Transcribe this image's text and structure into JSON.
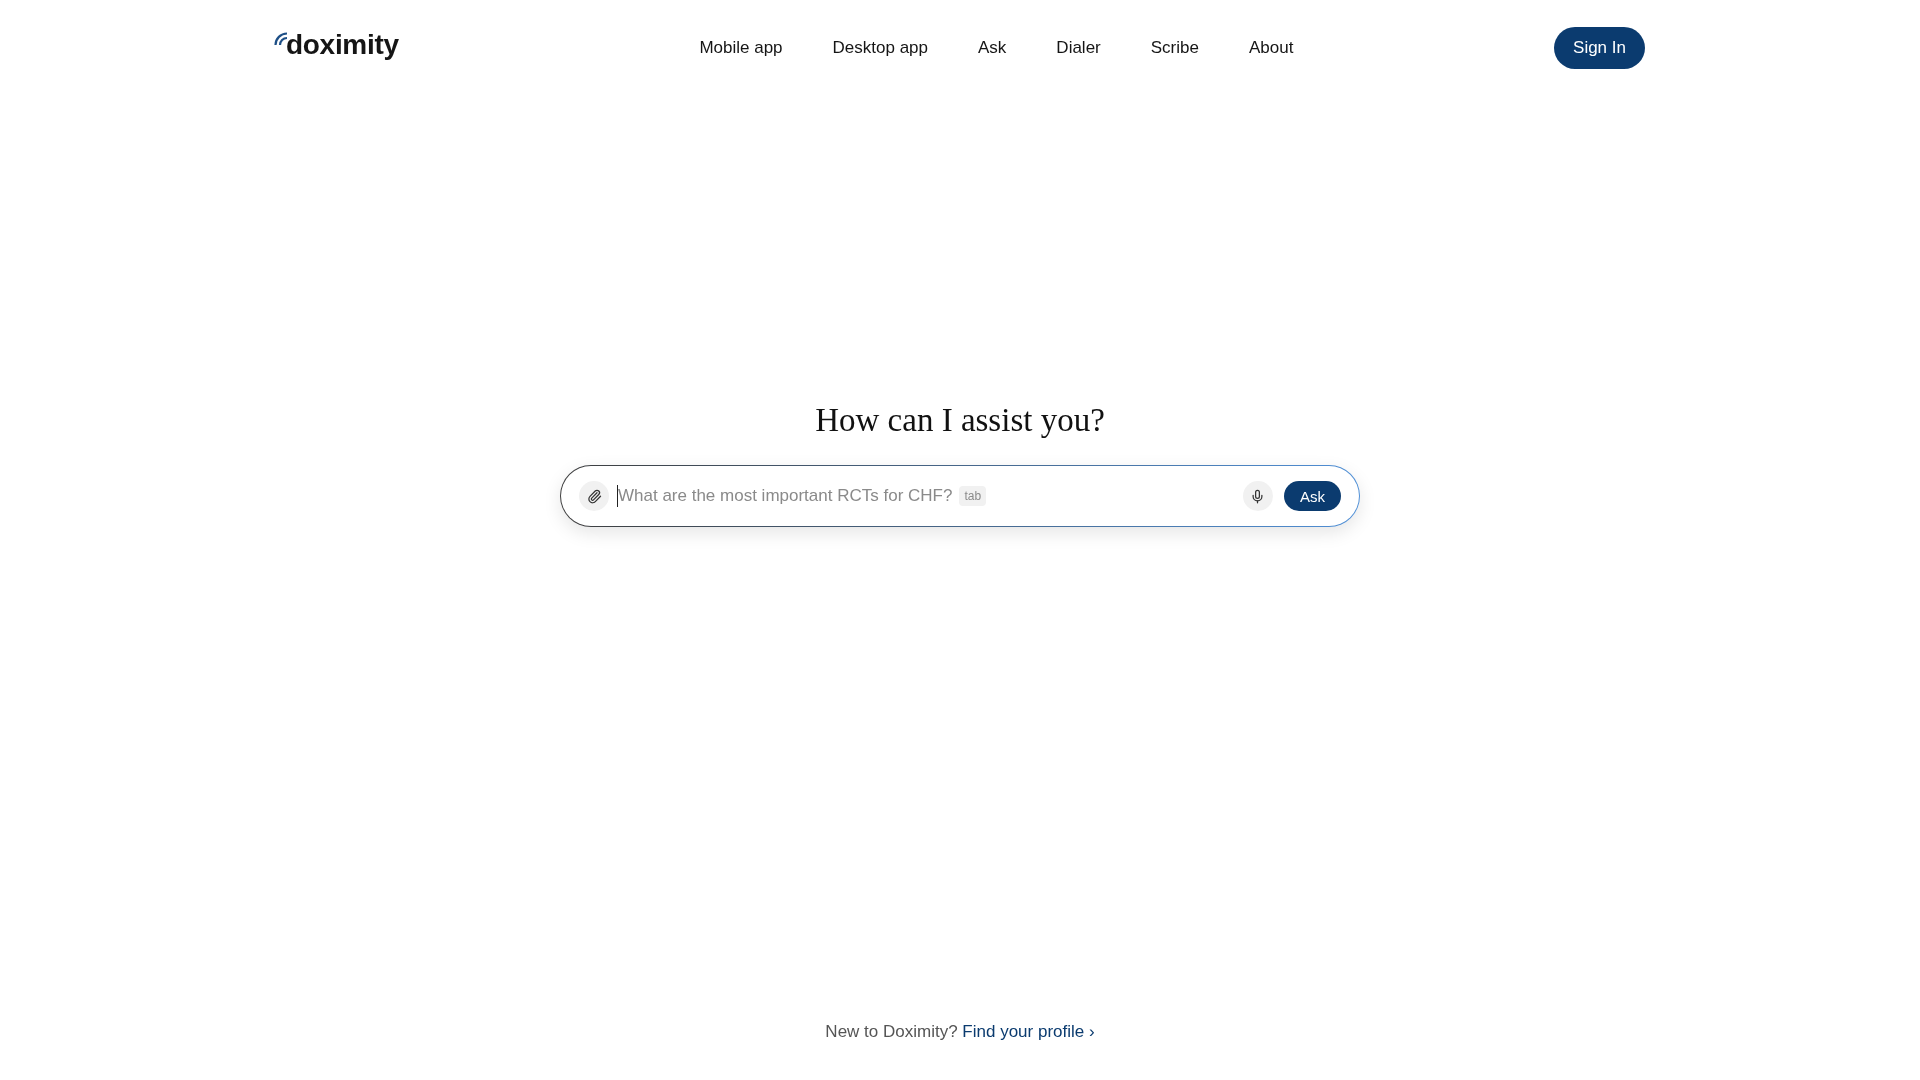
{
  "header": {
    "logo": {
      "text": "doximity"
    },
    "nav": [
      "Mobile app",
      "Desktop app",
      "Ask",
      "Dialer",
      "Scribe",
      "About"
    ],
    "sign_in": {
      "label": "Sign In"
    }
  },
  "main": {
    "heading": "How can I assist you?",
    "ask_bar": {
      "input": {
        "placeholder": "What are the most important RCTs for CHF?",
        "focused": true
      },
      "key_hint": "tab",
      "submit": {
        "label": "Ask"
      }
    }
  },
  "footer": {
    "prompt": "New to Doximity?",
    "link": {
      "label": "Find your profile ›"
    }
  }
}
